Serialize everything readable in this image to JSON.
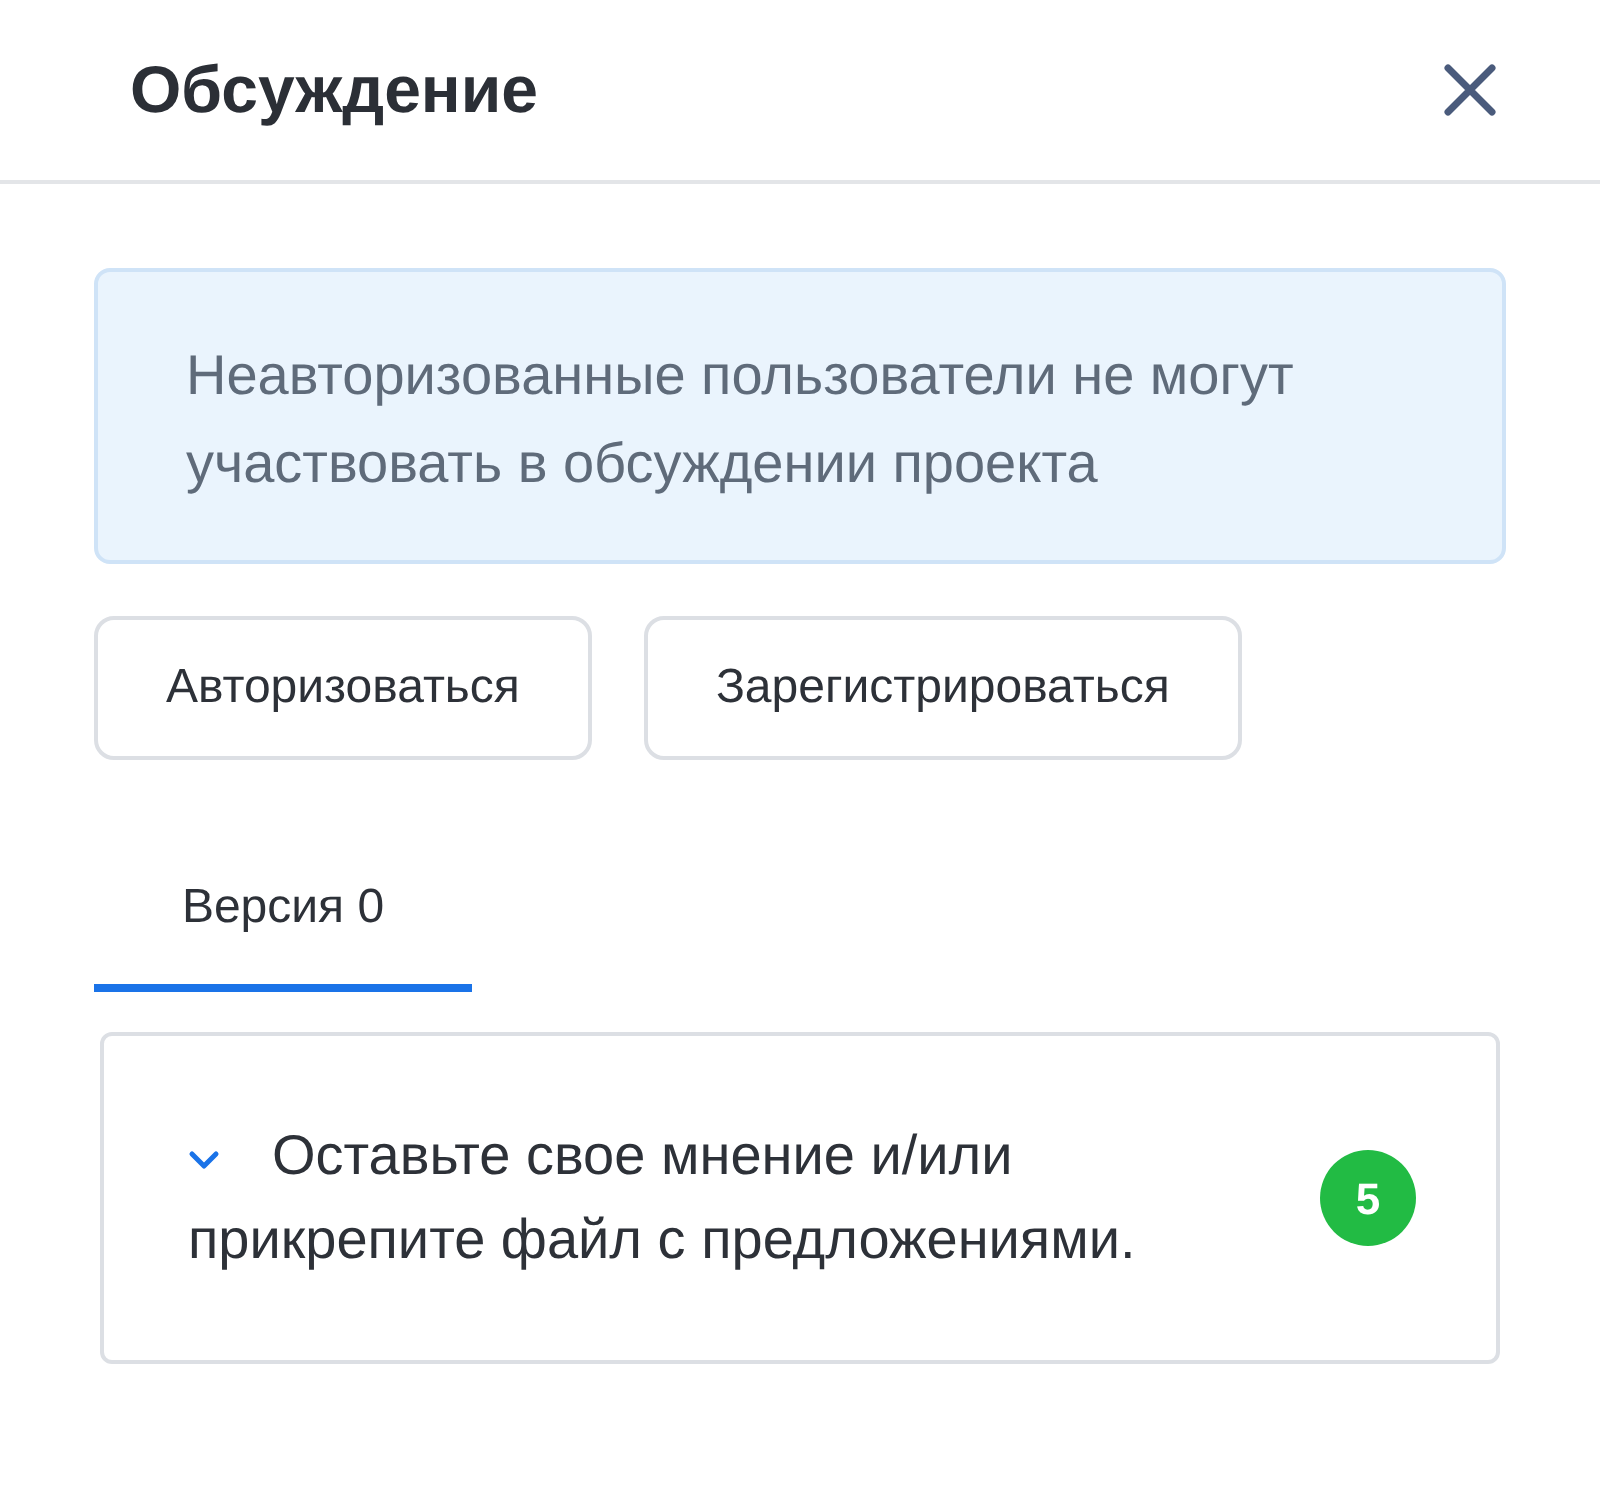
{
  "header": {
    "title": "Обсуждение"
  },
  "notice": {
    "text": "Неавторизованные пользователи не могут участвовать в обсуждении проекта"
  },
  "buttons": [
    "Авторизоваться",
    "Зарегистрироваться"
  ],
  "tabs": [
    {
      "label": "Версия 0",
      "selected": true
    }
  ],
  "accordion": {
    "text": "Оставьте свое мнение и/или прикрепите файл с предложениями.",
    "expanded": false,
    "badge": "5"
  }
}
